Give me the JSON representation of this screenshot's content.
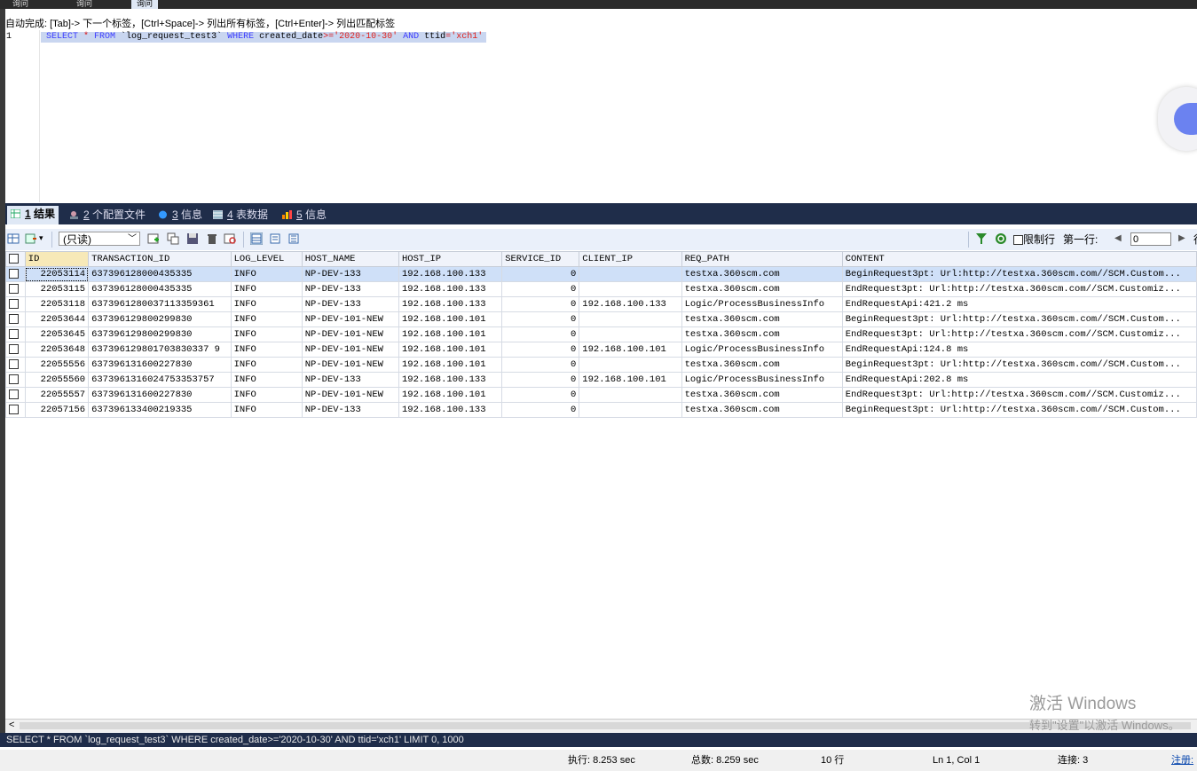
{
  "top_tabs": [
    "询问",
    "询问",
    "询问"
  ],
  "autocomplete_hint": "自动完成: [Tab]-> 下一个标签，[Ctrl+Space]-> 列出所有标签，[Ctrl+Enter]-> 列出匹配标签",
  "editor": {
    "line_number": "1",
    "sql": {
      "kw_select": "SELECT",
      "star": " * ",
      "kw_from": "FROM",
      "table": " `log_request_test3` ",
      "kw_where": "WHERE",
      "col": " created_date",
      "op": ">=",
      "date": "'2020-10-30'",
      "kw_and": " AND ",
      "col2": "ttid",
      "eq": "=",
      "val": "'xch1'"
    }
  },
  "result_tabs": [
    {
      "num": "1",
      "label": " 结果"
    },
    {
      "num": "2",
      "label": " 个配置文件"
    },
    {
      "num": "3",
      "label": " 信息"
    },
    {
      "num": "4",
      "label": " 表数据"
    },
    {
      "num": "5",
      "label": " 信息"
    }
  ],
  "toolbar": {
    "mode": "(只读)",
    "limit_rows": "限制行",
    "first_row_label": "第一行:",
    "first_row_value": "0",
    "rows_tail": "行"
  },
  "grid": {
    "columns": [
      "ID",
      "TRANSACTION_ID",
      "LOG_LEVEL",
      "HOST_NAME",
      "HOST_IP",
      "SERVICE_ID",
      "CLIENT_IP",
      "REQ_PATH",
      "CONTENT"
    ],
    "rows": [
      [
        "22053114",
        "637396128000435335",
        "INFO",
        "NP-DEV-133",
        "192.168.100.133",
        "0",
        "",
        "testxa.360scm.com",
        "BeginRequest3pt: Url:http://testxa.360scm.com//SCM.Custom..."
      ],
      [
        "22053115",
        "637396128000435335",
        "INFO",
        "NP-DEV-133",
        "192.168.100.133",
        "0",
        "",
        "testxa.360scm.com",
        "EndRequest3pt: Url:http://testxa.360scm.com//SCM.Customiz..."
      ],
      [
        "22053118",
        "6373961280037113359361",
        "INFO",
        "NP-DEV-133",
        "192.168.100.133",
        "0",
        "192.168.100.133",
        "Logic/ProcessBusinessInfo",
        "EndRequestApi:421.2 ms"
      ],
      [
        "22053644",
        "637396129800299830",
        "INFO",
        "NP-DEV-101-NEW",
        "192.168.100.101",
        "0",
        "",
        "testxa.360scm.com",
        "BeginRequest3pt: Url:http://testxa.360scm.com//SCM.Custom..."
      ],
      [
        "22053645",
        "637396129800299830",
        "INFO",
        "NP-DEV-101-NEW",
        "192.168.100.101",
        "0",
        "",
        "testxa.360scm.com",
        "EndRequest3pt: Url:http://testxa.360scm.com//SCM.Customiz..."
      ],
      [
        "22053648",
        "637396129801703830337 9",
        "INFO",
        "NP-DEV-101-NEW",
        "192.168.100.101",
        "0",
        "192.168.100.101",
        "Logic/ProcessBusinessInfo",
        "EndRequestApi:124.8 ms"
      ],
      [
        "22055556",
        "637396131600227830",
        "INFO",
        "NP-DEV-101-NEW",
        "192.168.100.101",
        "0",
        "",
        "testxa.360scm.com",
        "BeginRequest3pt: Url:http://testxa.360scm.com//SCM.Custom..."
      ],
      [
        "22055560",
        "6373961316024753353757",
        "INFO",
        "NP-DEV-133",
        "192.168.100.133",
        "0",
        "192.168.100.101",
        "Logic/ProcessBusinessInfo",
        "EndRequestApi:202.8 ms"
      ],
      [
        "22055557",
        "637396131600227830",
        "INFO",
        "NP-DEV-101-NEW",
        "192.168.100.101",
        "0",
        "",
        "testxa.360scm.com",
        "EndRequest3pt: Url:http://testxa.360scm.com//SCM.Customiz..."
      ],
      [
        "22057156",
        "637396133400219335",
        "INFO",
        "NP-DEV-133",
        "192.168.100.133",
        "0",
        "",
        "testxa.360scm.com",
        "BeginRequest3pt: Url:http://testxa.360scm.com//SCM.Custom..."
      ]
    ]
  },
  "watermark": {
    "line1": "激活 Windows",
    "line2": "转到\"设置\"以激活 Windows。"
  },
  "query_bar": "SELECT * FROM `log_request_test3` WHERE created_date>='2020-10-30' AND ttid='xch1' LIMIT 0, 1000",
  "status": {
    "exec": "执行: 8.253 sec",
    "total": "总数: 8.259 sec",
    "rows": "10 行",
    "position": "Ln 1, Col 1",
    "connections": "连接: 3",
    "register": "注册:"
  }
}
